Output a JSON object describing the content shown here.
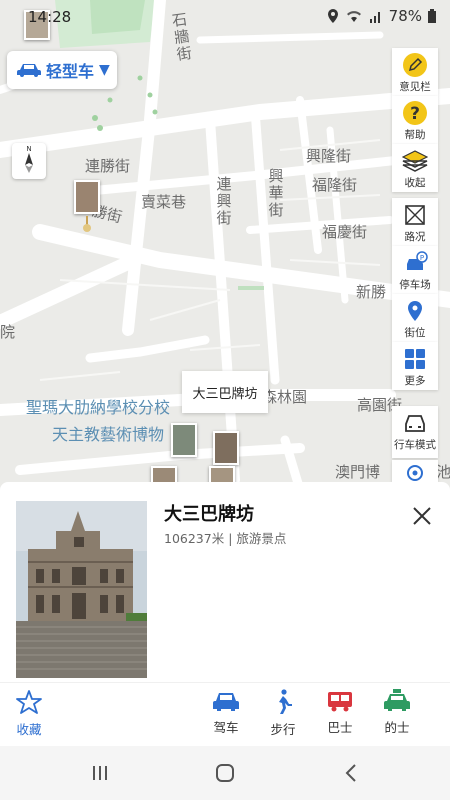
{
  "status_bar": {
    "time": "14:28",
    "battery": "78%"
  },
  "vehicle_selector": {
    "label": "轻型车",
    "caret": "▼"
  },
  "compass": {
    "label": "N"
  },
  "toolbar": [
    {
      "name": "feedback",
      "label": "意见栏"
    },
    {
      "name": "help",
      "label": "帮助"
    },
    {
      "name": "collapse",
      "label": "收起"
    },
    {
      "name": "traffic",
      "label": "路况"
    },
    {
      "name": "parking",
      "label": "停车场"
    },
    {
      "name": "street-view",
      "label": "街位"
    },
    {
      "name": "more",
      "label": "更多"
    },
    {
      "name": "drive-mode",
      "label": "行车模式"
    }
  ],
  "map": {
    "streets": {
      "lianshengjie": "連勝街",
      "lianshengjie2": "勝街",
      "maicaixiang": "賣菜巷",
      "lianxingjie": "連興街",
      "xinghuajie": "興華街",
      "xinglongjie": "興隆街",
      "fulongjie": "福隆街",
      "fuqingjie": "福慶街",
      "shiqiangjie": "石牆街",
      "xinsheng": "新勝",
      "yuan": "院",
      "senlinyuan": "森林園",
      "gaoyuanjie": "高園街",
      "aomenbo": "澳門博"
    },
    "places": {
      "school": "聖瑪大肋納學校分校",
      "museum": "天主教藝術博物"
    },
    "callout": "大三巴牌坊",
    "partial_chi": "池"
  },
  "card": {
    "title": "大三巴牌坊",
    "subtitle": "106237米 | 旅游景点"
  },
  "actions": {
    "favorite": "收藏",
    "drive": "驾车",
    "walk": "步行",
    "bus": "巴士",
    "taxi": "的士"
  },
  "colors": {
    "accent_blue": "#2e6fd0",
    "bus_red": "#d9363e",
    "taxi_green": "#2e9b62",
    "map_bg": "#ebebe8",
    "map_road": "#ffffff",
    "label_blue": "#5c8fb3"
  }
}
